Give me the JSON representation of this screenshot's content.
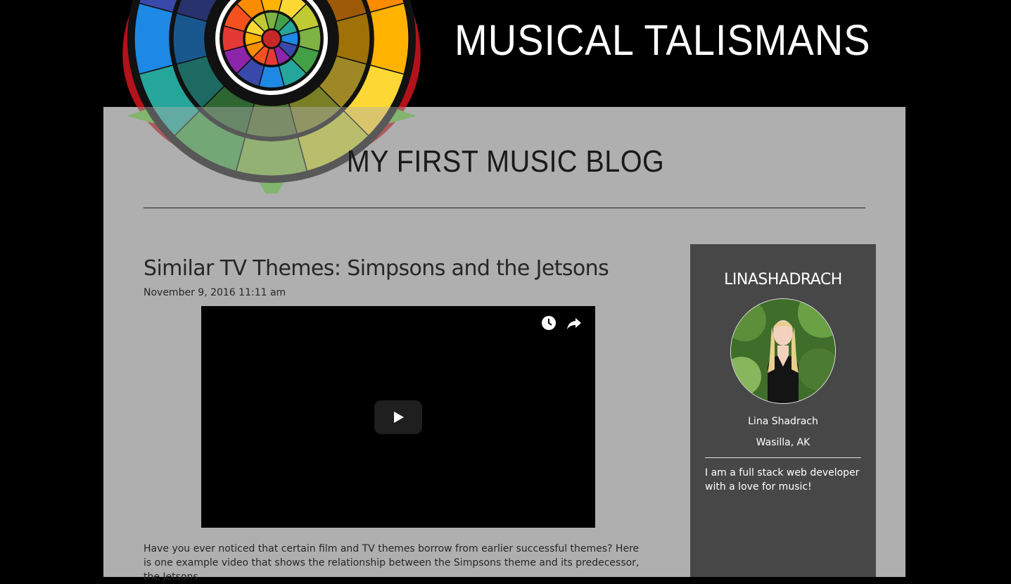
{
  "header": {
    "site_title": "MUSICAL TALISMANS",
    "logo_icon": "color-wheel-logo-icon"
  },
  "blog": {
    "title": "MY FIRST MUSIC BLOG"
  },
  "post": {
    "title": "Similar TV Themes: Simpsons and the Jetsons",
    "date": "November 9, 2016 11:11 am",
    "body": "Have you ever noticed that certain film and TV themes borrow from earlier successful themes? Here is one example video that shows the relationship between the Simpsons theme and its predecessor, the Jetsons.",
    "video": {
      "icons": [
        "clock-icon",
        "share-icon",
        "play-icon"
      ]
    }
  },
  "sidebar": {
    "username": "LINASHADRACH",
    "name": "Lina Shadrach",
    "location": "Wasilla, AK",
    "bio": "I am a full stack web developer with a love for music!"
  },
  "colors": {
    "background": "#000000",
    "page": "#afafaf",
    "sidebar": "#474747",
    "text_dark": "#262626",
    "text_light": "#ffffff"
  }
}
